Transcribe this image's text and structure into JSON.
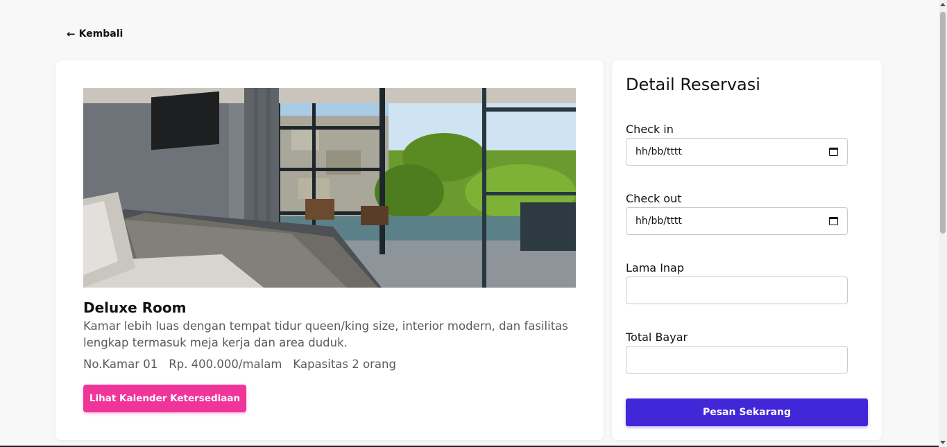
{
  "nav": {
    "back_label": "Kembali",
    "back_icon": "arrow-left-icon"
  },
  "room": {
    "title": "Deluxe Room",
    "description": "Kamar lebih luas dengan tempat tidur queen/king size, interior modern, dan fasilitas lengkap termasuk meja kerja dan area duduk.",
    "number": "No.Kamar 01",
    "price": "Rp. 400.000/malam",
    "capacity": "Kapasitas 2 orang",
    "calendar_button": "Lihat Kalender Ketersediaan"
  },
  "reservation": {
    "title": "Detail Reservasi",
    "check_in": {
      "label": "Check in",
      "placeholder": "hh/bb/tttt"
    },
    "check_out": {
      "label": "Check out",
      "placeholder": "hh/bb/tttt"
    },
    "duration": {
      "label": "Lama Inap",
      "value": ""
    },
    "total": {
      "label": "Total Bayar",
      "value": ""
    },
    "submit_button": "Pesan Sekarang"
  },
  "colors": {
    "calendar_button": "#f0359a",
    "submit_button": "#4227d8",
    "page_background": "#f8f8f8"
  }
}
